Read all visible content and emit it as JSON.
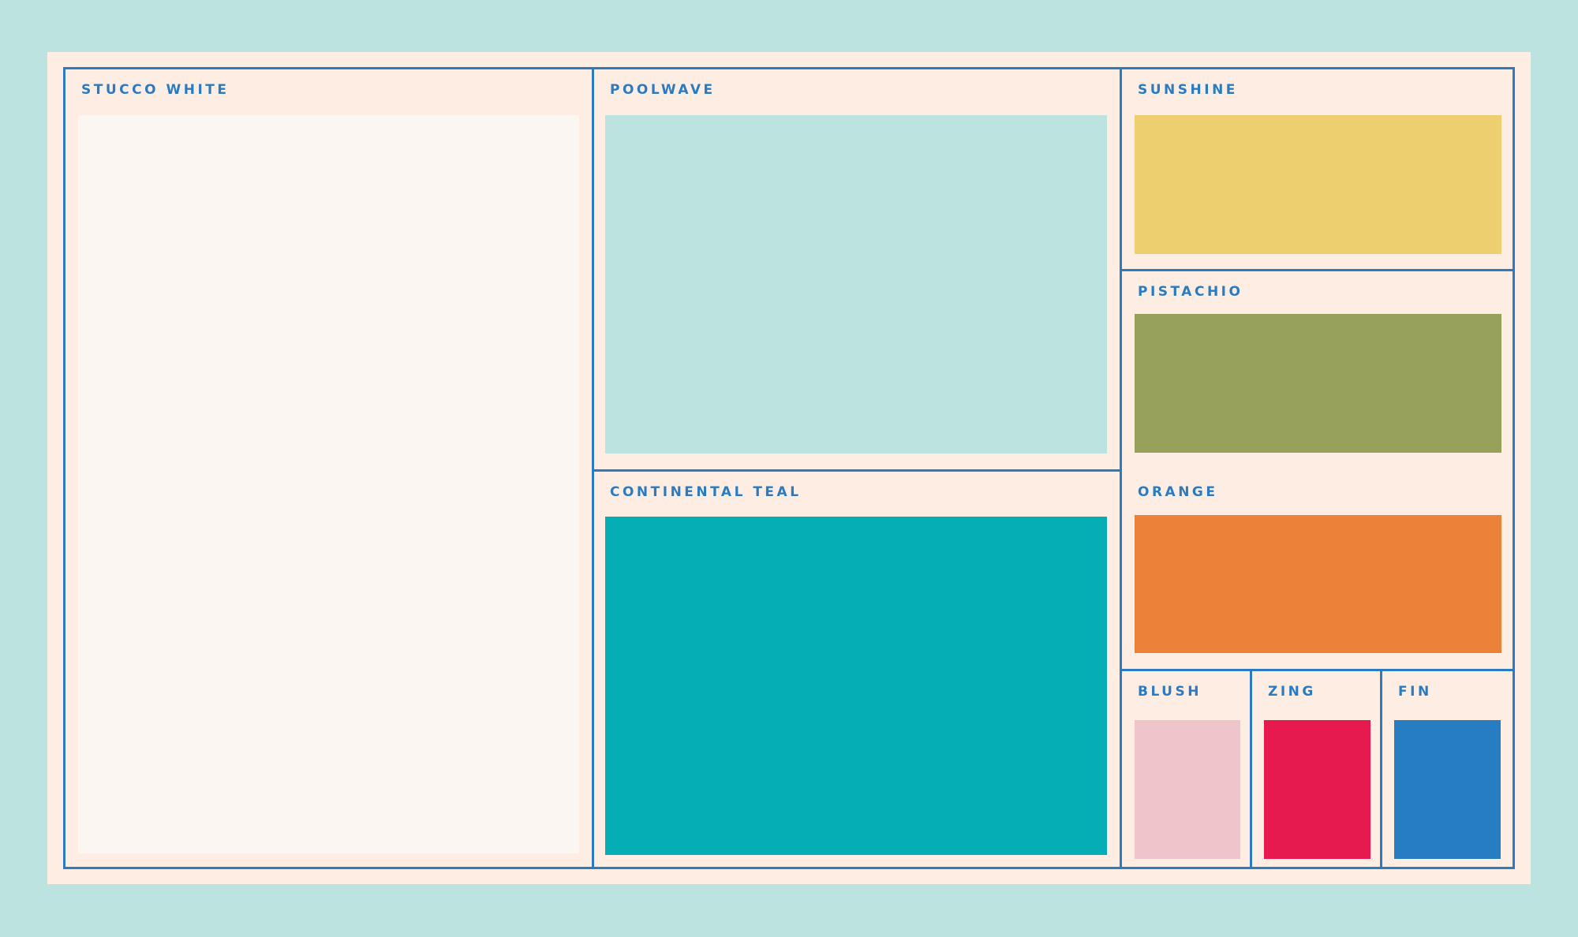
{
  "swatches": {
    "stucco_white": {
      "name": "STUCCO WHITE",
      "color": "#fbf6f2"
    },
    "poolwave": {
      "name": "POOLWAVE",
      "color": "#bde3e0"
    },
    "continental_teal": {
      "name": "CONTINENTAL TEAL",
      "color": "#05adb5"
    },
    "sunshine": {
      "name": "SUNSHINE",
      "color": "#edcf70"
    },
    "pistachio": {
      "name": "PISTACHIO",
      "color": "#98a15b"
    },
    "orange": {
      "name": "ORANGE",
      "color": "#ec823a"
    },
    "blush": {
      "name": "BLUSH",
      "color": "#efc4cb"
    },
    "zing": {
      "name": "ZING",
      "color": "#e71a4f"
    },
    "fin": {
      "name": "FIN",
      "color": "#267dc2"
    }
  },
  "colors": {
    "background": "#bde3e0",
    "panel": "#feede3",
    "line": "#2a7bc1",
    "label": "#2a7bc1"
  }
}
